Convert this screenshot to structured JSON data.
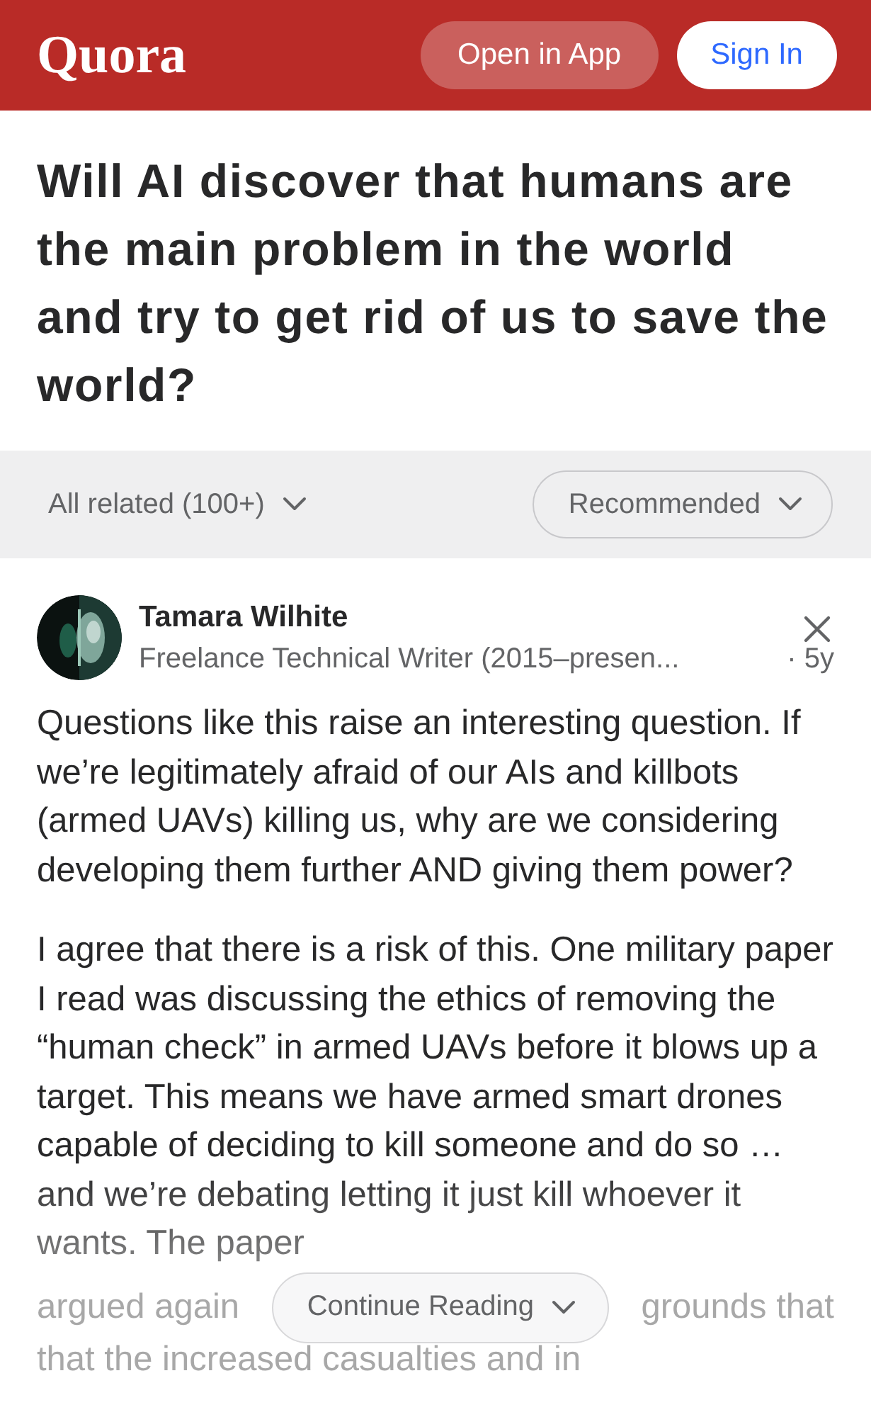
{
  "header": {
    "logo": "Quora",
    "open_in_app": "Open in App",
    "sign_in": "Sign In"
  },
  "question": {
    "title": "Will AI discover that humans are the main problem in the world and try to get rid of us to save the world?"
  },
  "filters": {
    "related": "All related (100+)",
    "sort": "Recommended"
  },
  "answer": {
    "author": "Tamara Wilhite",
    "credential": "Freelance Technical Writer (2015–presen...",
    "age": "· 5y",
    "paragraphs": [
      "Questions like this raise an interesting question. If we’re legitimately afraid of our AIs and killbots (armed UAVs) killing us, why are we considering developing them further AND giving them power?",
      "I agree that there is a risk of this. One military paper I read was discussing the ethics of removing the “human check” in armed UAVs before it blows up a target. This means we have armed smart drones capable of deciding to kill someone and do so … and we’re debating letting it just kill whoever it wants. The paper"
    ],
    "faded_left": "argued again",
    "faded_right": "grounds that",
    "faded_last": "that the increased casualties and in",
    "continue": "Continue Reading"
  }
}
